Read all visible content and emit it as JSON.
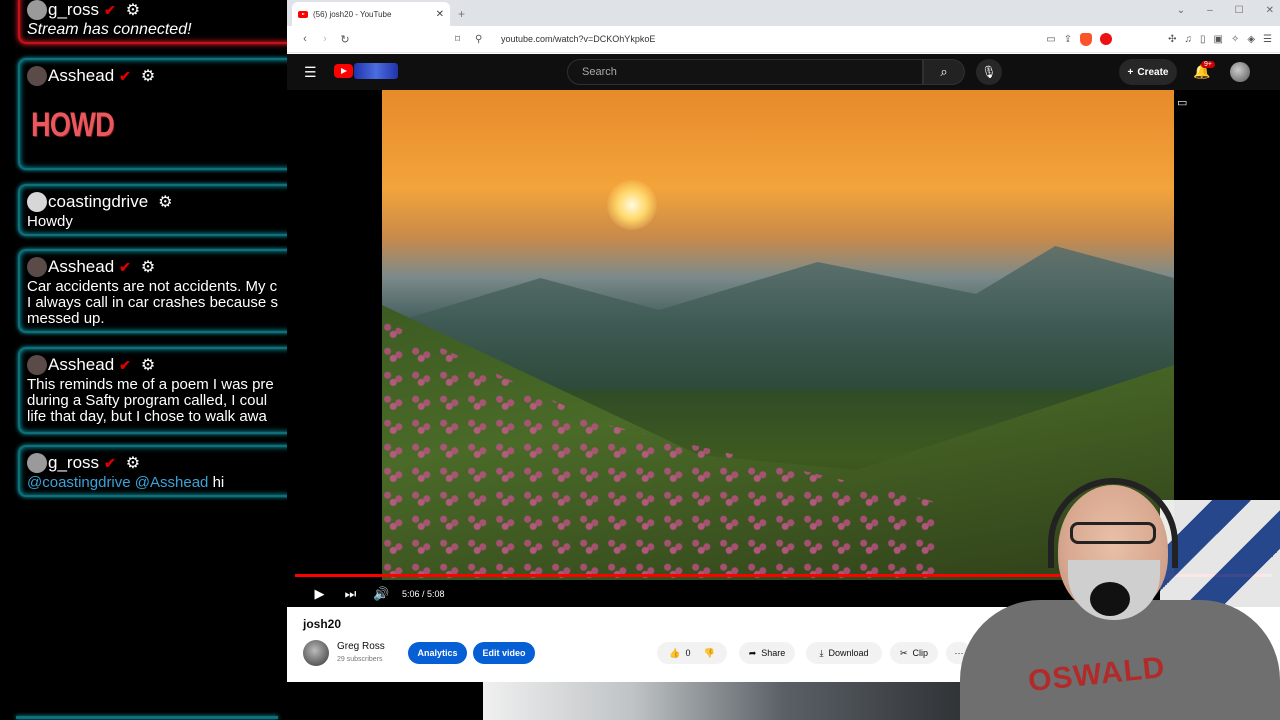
{
  "chat": {
    "messages": [
      {
        "user": "g_ross",
        "text": "Stream has connected!",
        "style": "system"
      },
      {
        "user": "Asshead",
        "text": "HOWD",
        "style": "image"
      },
      {
        "user": "coastingdrive",
        "text": "Howdy"
      },
      {
        "user": "Asshead",
        "lines": [
          "Car accidents are not accidents. My c",
          "I always call in car crashes because s",
          "messed up."
        ]
      },
      {
        "user": "Asshead",
        "lines": [
          "This reminds me of a poem I was pre",
          "during a Safty program called, I coul",
          "life that day, but I chose to walk awa"
        ]
      },
      {
        "user": "g_ross",
        "mentions": [
          "@coastingdrive",
          "@Asshead"
        ],
        "text": "hi"
      }
    ],
    "icons": {
      "verified": "verified-check-icon",
      "settings": "gear-icon"
    }
  },
  "browser": {
    "tab_title": "(56) josh20 - YouTube",
    "url": "youtube.com/watch?v=DCKOhYkpkoE"
  },
  "youtube": {
    "search_placeholder": "Search",
    "create_label": "Create",
    "notification_count": "9+",
    "video": {
      "time": "5:06 / 5:08",
      "progress_fraction": 0.994,
      "title": "josh20"
    },
    "channel": {
      "name": "Greg Ross",
      "subscribers": "29 subscribers"
    },
    "actions": {
      "analytics": "Analytics",
      "edit_video": "Edit video",
      "likes": "0",
      "share": "Share",
      "download": "Download",
      "clip": "Clip",
      "more": "···"
    }
  },
  "webcam": {
    "shirt_text": "OSWALD"
  },
  "colors": {
    "chat_border": "#0f6f7a",
    "chat_glow": "#0aa6b5",
    "first_msg_border": "#c4111a",
    "verified": "#dd0000",
    "mention": "#3aa3d8",
    "yt_red": "#ff0000",
    "yt_blue": "#065fd4"
  }
}
